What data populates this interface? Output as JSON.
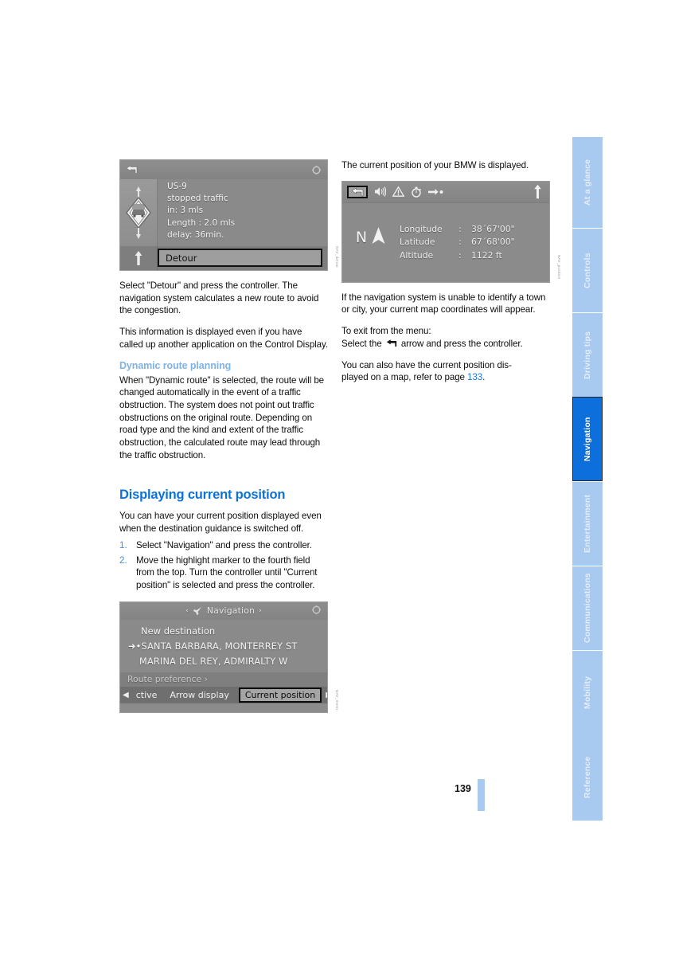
{
  "document": {
    "page_number": "139",
    "active_section": "Navigation"
  },
  "sidebar": {
    "tabs": [
      {
        "label": "At a glance",
        "active": false
      },
      {
        "label": "Controls",
        "active": false
      },
      {
        "label": "Driving tips",
        "active": false
      },
      {
        "label": "Navigation",
        "active": true
      },
      {
        "label": "Entertainment",
        "active": false
      },
      {
        "label": "Communications",
        "active": false
      },
      {
        "label": "Mobility",
        "active": false
      },
      {
        "label": "Reference",
        "active": false
      }
    ]
  },
  "left_column": {
    "figure_detour": {
      "caption_code": "NAV_detour",
      "street": "US-9",
      "condition": "stopped traffic",
      "distance": "in: 3 mls",
      "length": "Length :  2.0 mls",
      "delay": "delay: 36min.",
      "button_label": "Detour",
      "back_icon": "back-arrow-icon",
      "rotate_icon": "rotate-controller-icon",
      "sign_icon": "traffic-jam-warning-icon",
      "direction_icon": "straight-ahead-arrow-icon"
    },
    "para_1": "Select \"Detour\" and press the controller. The navigation system calculates a new route to avoid the congestion.",
    "para_2": "This information is displayed even if you have called up another application on the Control Display.",
    "subheading": "Dynamic route planning",
    "para_3": "When \"Dynamic route\" is selected, the route will be changed automatically in the event of a traffic obstruction. The system does not point out traffic obstructions on the original route. Depending on road type and the kind and extent of the traffic obstruction, the calculated route may lead through the traffic obstruction.",
    "heading": "Displaying current position",
    "para_4": "You can have your current position displayed even when the destination guidance is switched off.",
    "steps": [
      {
        "number": "1.",
        "text": "Select \"Navigation\" and press the controller."
      },
      {
        "number": "2.",
        "text": "Move the highlight marker to the fourth field from the top. Turn the controller until \"Current position\" is selected and press the controller."
      }
    ],
    "figure_navmenu": {
      "caption_code": "NAV_menu",
      "title": "Navigation",
      "title_left_caret": "‹",
      "title_right_caret": "›",
      "pin_icon": "navigation-pin-icon",
      "rotate_icon": "rotate-controller-icon",
      "items": [
        "New destination",
        "SANTA BARBARA, MONTERREY ST",
        "MARINA DEL REY, ADMIRALTY W"
      ],
      "destination_marker": "➜•",
      "route_preference": "Route preference ›",
      "tabbar": {
        "left_caret": "◀",
        "right_caret": "▶",
        "items": [
          "ctive",
          "Arrow display"
        ],
        "selected": "Current position"
      }
    }
  },
  "right_column": {
    "intro": "The current position of your BMW is displayed.",
    "figure_position": {
      "caption_code": "NAV_position",
      "toolbar_icons": [
        "back-arrow-icon",
        "speaker-icon",
        "warning-triangle-icon",
        "stopwatch-icon",
        "arrow-dot-icon"
      ],
      "heading_arrow_icon": "north-heading-arrow-icon",
      "compass_letter": "N",
      "compass_needle_icon": "compass-needle-icon",
      "rows": [
        {
          "label": "Longitude",
          "sep": ":",
          "value": "38´67'00\""
        },
        {
          "label": "Latitude",
          "sep": ":",
          "value": "67´68'00\""
        },
        {
          "label": "Altitude",
          "sep": ":",
          "value": "1122 ft"
        }
      ]
    },
    "para_1": "If the navigation system is unable to identify a town or city, your current map coordinates will appear.",
    "para_2_line1": "To exit from the menu:",
    "para_2_line2_a": "Select the",
    "para_2_line2_b": "arrow and press the controller.",
    "back_arrow_icon": "back-arrow-inline-icon",
    "para_3_a": "You can also have the current position dis-played on a map, refer to page",
    "para_3_prefix": "You can also have the current position dis-",
    "para_3_line2": "played on a map, refer to page",
    "page_ref": "133",
    "period": "."
  },
  "colors": {
    "heading_blue": "#0d72d8",
    "subheading_blue": "#7fb3e8",
    "tab_inactive": "#a8caf0",
    "tab_active": "#0d6fdb",
    "link_blue": "#2277dd",
    "screen_gray": "#8c8c8c"
  }
}
